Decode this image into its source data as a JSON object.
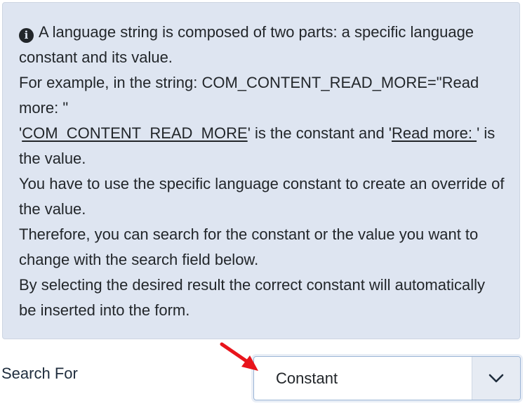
{
  "info": {
    "icon": "info-circle-icon",
    "line1": "A language string is composed of two parts: a specific language constant and its value.",
    "line2": "For example, in the string: COM_CONTENT_READ_MORE=\"Read more: \"",
    "line3_prefix": "'",
    "line3_constant": "COM_CONTENT_READ_MORE",
    "line3_mid": "' is the constant and '",
    "line3_value": "Read more: ",
    "line3_suffix": "' is the value.",
    "line4": "You have to use the specific language constant to create an override of the value.",
    "line5": "Therefore, you can search for the constant or the value you want to change with the search field below.",
    "line6": "By selecting the desired result the correct constant will automatically be inserted into the form."
  },
  "search": {
    "label": "Search For",
    "selected": "Constant"
  },
  "colors": {
    "info_background": "#dee5f1",
    "annotation_arrow": "#e8141b"
  }
}
